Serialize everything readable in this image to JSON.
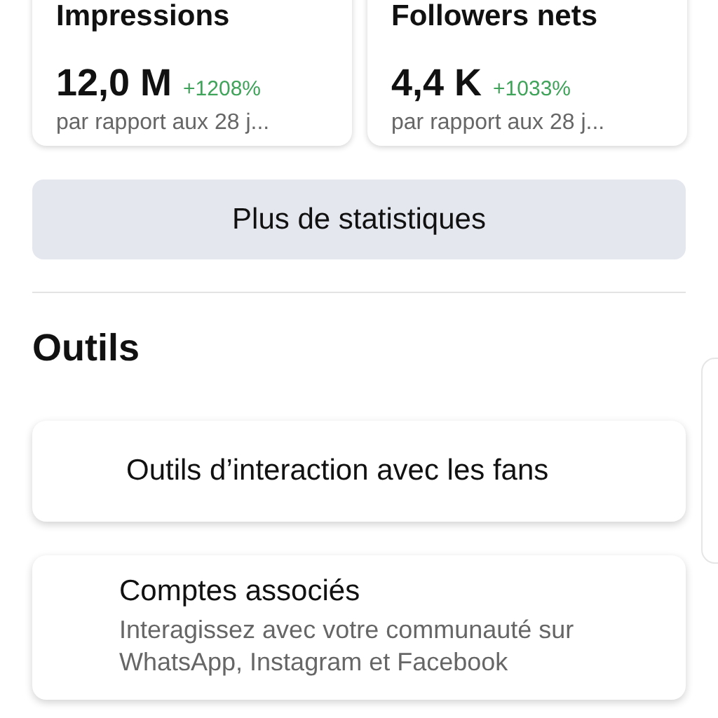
{
  "stats": [
    {
      "title": "Impressions",
      "value": "12,0 M",
      "change": "+1208%",
      "note": "par rapport aux 28 j..."
    },
    {
      "title": "Followers nets",
      "value": "4,4 K",
      "change": "+1033%",
      "note": "par rapport aux 28 j..."
    }
  ],
  "more_button": "Plus de statistiques",
  "tools": {
    "heading": "Outils",
    "items": [
      {
        "kind": "simple",
        "title": "Outils d’interaction avec les fans"
      },
      {
        "kind": "detailed",
        "title": "Comptes associés",
        "description": "Interagissez avec votre communauté sur WhatsApp, Instagram et Facebook"
      }
    ]
  }
}
